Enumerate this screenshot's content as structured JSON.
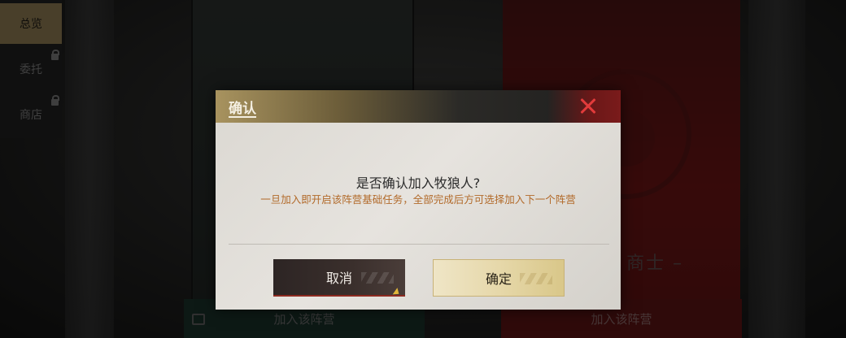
{
  "sidebar": {
    "items": [
      {
        "label": "总览",
        "active": true,
        "locked": false
      },
      {
        "label": "委托",
        "active": false,
        "locked": true
      },
      {
        "label": "商店",
        "active": false,
        "locked": true
      }
    ]
  },
  "background": {
    "faction_name_partial": "商士 –",
    "join_left_label": "加入该阵营",
    "join_right_label": "加入该阵营"
  },
  "dialog": {
    "title": "确认",
    "question": "是否确认加入牧狼人?",
    "subtitle": "一旦加入即开启该阵营基础任务，全部完成后方可选择加入下一个阵营",
    "cancel_label": "取消",
    "confirm_label": "确定",
    "close_icon": "close-icon"
  },
  "colors": {
    "accent_gold": "#a8935f",
    "accent_red": "#e23b3b",
    "subtitle_orange": "#b26a2a"
  }
}
